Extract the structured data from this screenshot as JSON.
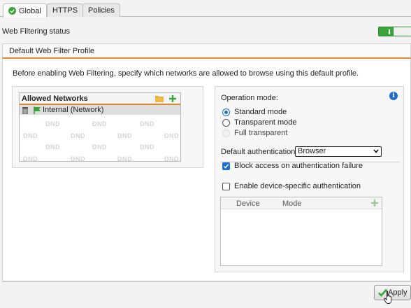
{
  "tabs": [
    {
      "label": "Global",
      "active": true
    },
    {
      "label": "HTTPS",
      "active": false
    },
    {
      "label": "Policies",
      "active": false
    }
  ],
  "status": {
    "label": "Web Filtering status",
    "enabled": true
  },
  "profile": {
    "title": "Default Web Filter Profile",
    "intro": "Before enabling Web Filtering, specify which networks are allowed to browse using this default profile."
  },
  "allowed_networks": {
    "title": "Allowed Networks",
    "items": [
      {
        "label": "Internal (Network)"
      }
    ],
    "watermark": "DND"
  },
  "operation": {
    "label": "Operation mode:",
    "options": [
      {
        "label": "Standard mode",
        "selected": true,
        "disabled": false
      },
      {
        "label": "Transparent mode",
        "selected": false,
        "disabled": false
      },
      {
        "label": "Full transparent",
        "selected": false,
        "disabled": true
      }
    ]
  },
  "auth": {
    "label": "Default authentication:",
    "selected": "Browser",
    "block_label": "Block access on authentication failure",
    "block_checked": true,
    "device_label": "Enable device-specific authentication",
    "device_checked": false
  },
  "device_table": {
    "columns": [
      "Device",
      "Mode"
    ]
  },
  "footer": {
    "apply_label": "Apply"
  },
  "colors": {
    "accent_orange": "#e08a2b",
    "toggle_green": "#3aa53a",
    "info_blue": "#1f6fc5",
    "check_blue": "#1a6fd0"
  }
}
